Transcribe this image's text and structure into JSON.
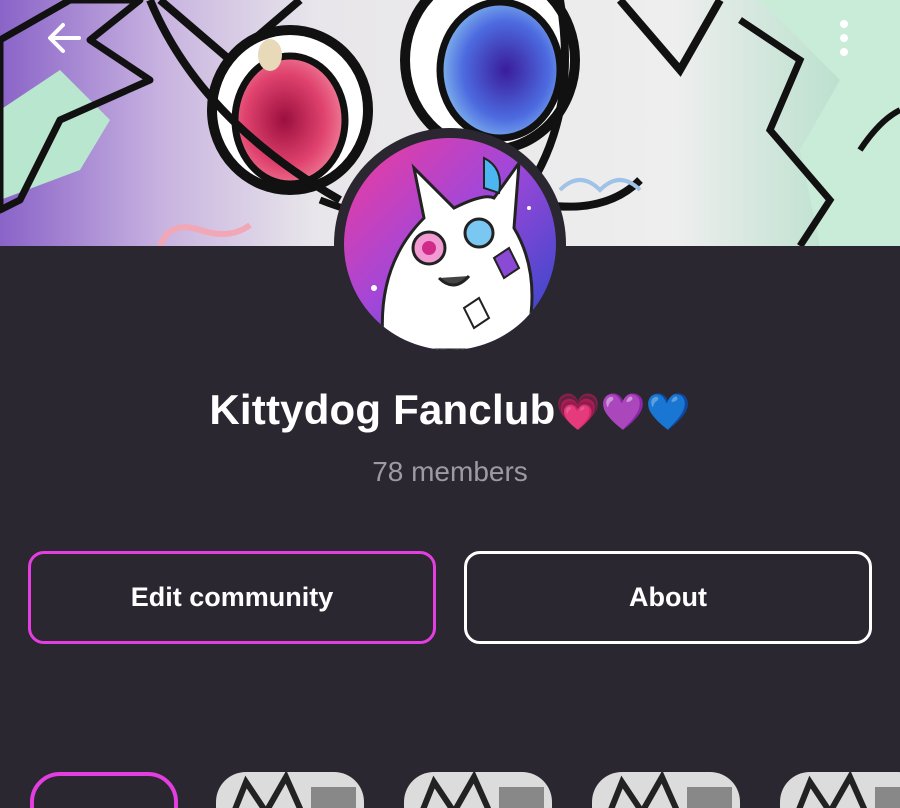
{
  "header": {
    "back_icon": "arrow-left-icon",
    "more_icon": "more-vertical-icon"
  },
  "community": {
    "name": "Kittydog Fanclub",
    "name_emoji": "💗💜💙",
    "members_text": "78 members"
  },
  "actions": {
    "edit_label": "Edit community",
    "about_label": "About"
  },
  "colors": {
    "background": "#2b2730",
    "accent": "#e23ee0",
    "muted_text": "#9d9aa2"
  }
}
